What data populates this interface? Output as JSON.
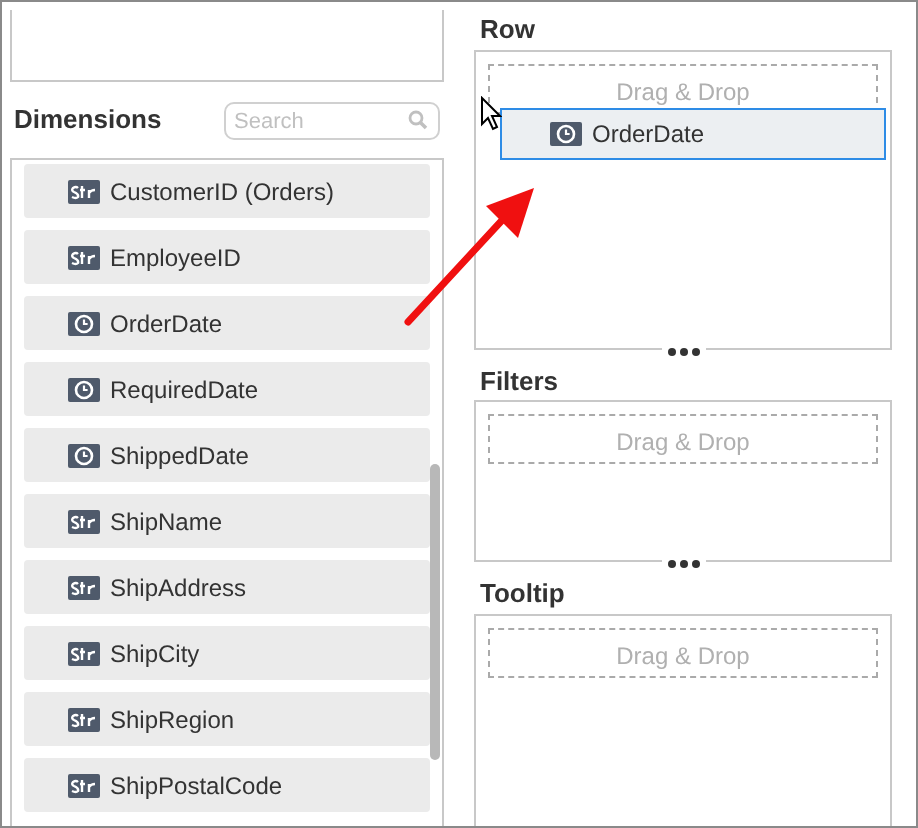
{
  "dimensions": {
    "title": "Dimensions",
    "search": {
      "placeholder": "Search"
    },
    "items": [
      {
        "label": "CustomerID (Orders)",
        "kind": "str"
      },
      {
        "label": "EmployeeID",
        "kind": "str"
      },
      {
        "label": "OrderDate",
        "kind": "date"
      },
      {
        "label": "RequiredDate",
        "kind": "date"
      },
      {
        "label": "ShippedDate",
        "kind": "date"
      },
      {
        "label": "ShipName",
        "kind": "str"
      },
      {
        "label": "ShipAddress",
        "kind": "str"
      },
      {
        "label": "ShipCity",
        "kind": "str"
      },
      {
        "label": "ShipRegion",
        "kind": "str"
      },
      {
        "label": "ShipPostalCode",
        "kind": "str"
      }
    ]
  },
  "sections": [
    {
      "title": "Row",
      "drop_hint": "Drag & Drop"
    },
    {
      "title": "Filters",
      "drop_hint": "Drag & Drop"
    },
    {
      "title": "Tooltip",
      "drop_hint": "Drag & Drop"
    }
  ],
  "dragged_item": {
    "label": "OrderDate",
    "kind": "date"
  }
}
